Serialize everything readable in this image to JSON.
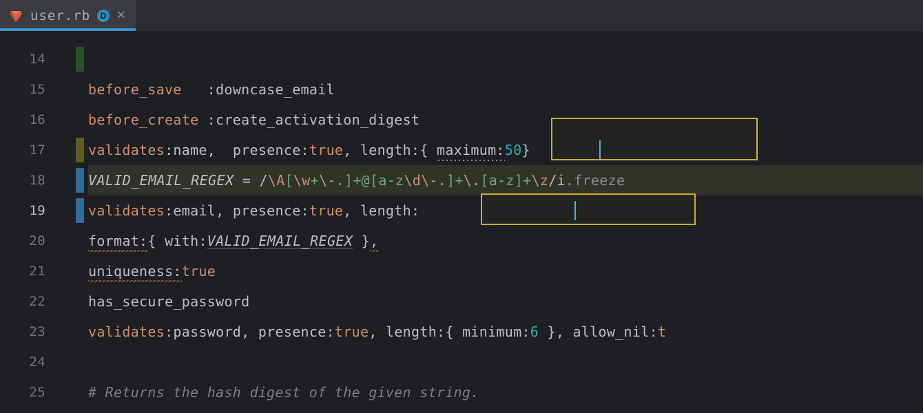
{
  "tab": {
    "filename": "user.rb",
    "modified_badge": "D"
  },
  "gutter": {
    "start": 14,
    "end": 25,
    "current_line": 19
  },
  "code": {
    "l14": "",
    "l15": {
      "method": "before_save",
      "sp": "   ",
      "sym": ":downcase_email"
    },
    "l16": {
      "method": "before_create",
      "sp": " ",
      "sym": ":create_activation_digest"
    },
    "l17": {
      "method": "validates",
      "sym": ":name",
      "sp": ",  ",
      "presence_k": "presence:",
      "true": "true",
      "length_k": "length:",
      "open": "{ ",
      "max_k": "maximum:",
      "max_v": "50",
      "close": "}"
    },
    "l18": {
      "const": "VALID_EMAIL_REGEX",
      "eq": " = ",
      "rx_open": "/",
      "rxA": "\\A",
      "rxBody1": "[",
      "rxW": "\\w",
      "rxBody2": "+",
      "rxEsc1": "\\-",
      "rxBody3": ".]",
      "rxPlus1": "+",
      "rxAt": "@",
      "rxClass": "[a-z",
      "rxD": "\\d",
      "rxDash": "\\-",
      "rxDot1": ".",
      "rxClose1": "]",
      "rxPlus2": "+",
      "rxDotE": "\\.",
      "rxClass2": "[a-z]",
      "rxPlus3": "+",
      "rxZ": "\\z",
      "rx_flags": "/i",
      "tail": ".freeze"
    },
    "l19": {
      "method": "validates",
      "sym": ":email",
      "presence_k": "presence:",
      "true": "true",
      "length_k": "length:"
    },
    "l20": {
      "format_k": "format:",
      "open": "{ ",
      "with_k": "with:",
      "const": "VALID_EMAIL_REGEX",
      "close": " }",
      "comma": ","
    },
    "l21": {
      "uniq_k": "uniqueness:",
      "true": "true"
    },
    "l22": {
      "call": "has_secure_password"
    },
    "l23": {
      "method": "validates",
      "sym": ":password",
      "presence_k": "presence:",
      "true": "true",
      "length_k": "length:",
      "open": "{ ",
      "min_k": "minimum:",
      "min_v": "6",
      "close": " }",
      "allow_k": "allow_nil:",
      "true2": "t"
    },
    "l24": "",
    "l25": {
      "comment": "# Returns the hash digest of the given string."
    }
  }
}
